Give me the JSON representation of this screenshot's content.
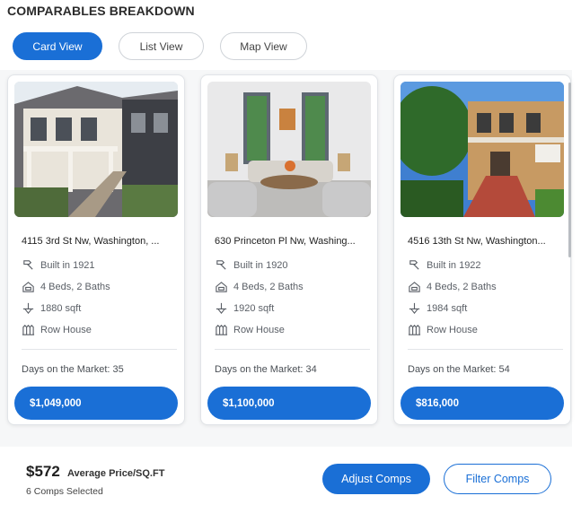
{
  "section_title": "COMPARABLES BREAKDOWN",
  "view_tabs": [
    {
      "label": "Card View",
      "active": true
    },
    {
      "label": "List View",
      "active": false
    },
    {
      "label": "Map View",
      "active": false
    }
  ],
  "cards": [
    {
      "address": "4115 3rd St Nw, Washington, ...",
      "built": "Built in 1921",
      "beds_baths": "4 Beds, 2 Baths",
      "sqft": "1880 sqft",
      "type": "Row House",
      "days_on_market": "Days on the Market: 35",
      "price": "$1,049,000"
    },
    {
      "address": "630 Princeton Pl Nw, Washing...",
      "built": "Built in 1920",
      "beds_baths": "4 Beds, 2 Baths",
      "sqft": "1920 sqft",
      "type": "Row House",
      "days_on_market": "Days on the Market: 34",
      "price": "$1,100,000"
    },
    {
      "address": "4516 13th St Nw, Washington...",
      "built": "Built in 1922",
      "beds_baths": "4 Beds, 2 Baths",
      "sqft": "1984 sqft",
      "type": "Row House",
      "days_on_market": "Days on the Market: 54",
      "price": "$816,000"
    }
  ],
  "summary": {
    "avg_price": "$572",
    "avg_label": "Average Price/SQ.FT",
    "comps_selected": "6 Comps Selected"
  },
  "actions": {
    "adjust_label": "Adjust Comps",
    "filter_label": "Filter Comps"
  },
  "colors": {
    "accent": "#1a6fd6",
    "icon": "#5a5f66"
  },
  "icons": [
    "hammer-icon",
    "house-bed-icon",
    "ruler-area-icon",
    "row-house-icon"
  ]
}
